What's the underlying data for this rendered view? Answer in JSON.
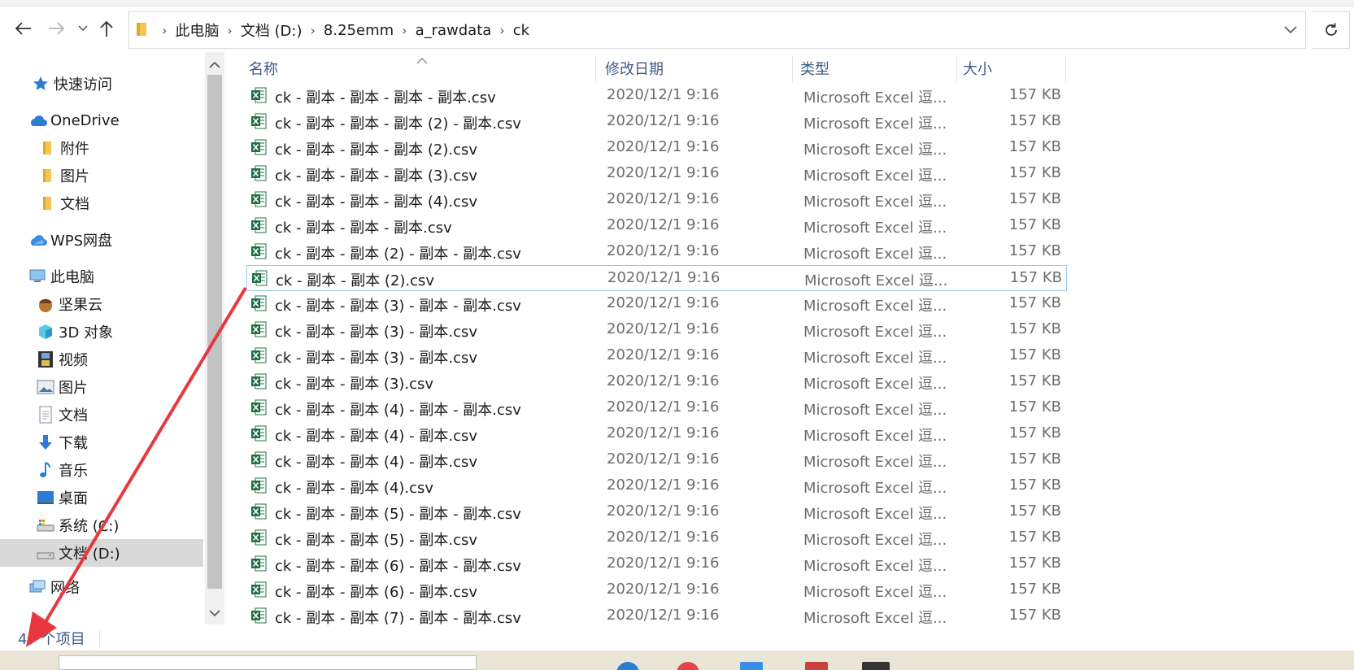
{
  "address": {
    "segments": [
      "此电脑",
      "文档 (D:)",
      "8.25emm",
      "a_rawdata",
      "ck"
    ]
  },
  "columns": {
    "name": "名称",
    "date": "修改日期",
    "type": "类型",
    "size": "大小"
  },
  "sidebar": {
    "items": [
      {
        "label": "快速访问",
        "icon": "star-icon"
      },
      {
        "label": "OneDrive",
        "icon": "cloud-icon"
      },
      {
        "label": "附件",
        "icon": "folder-icon"
      },
      {
        "label": "图片",
        "icon": "folder-icon"
      },
      {
        "label": "文档",
        "icon": "folder-icon"
      },
      {
        "label": "WPS网盘",
        "icon": "cloud-icon"
      },
      {
        "label": "此电脑",
        "icon": "computer-icon"
      },
      {
        "label": "坚果云",
        "icon": "nut-icon"
      },
      {
        "label": "3D 对象",
        "icon": "cube-icon"
      },
      {
        "label": "视频",
        "icon": "film-icon"
      },
      {
        "label": "图片",
        "icon": "picture-icon"
      },
      {
        "label": "文档",
        "icon": "document-icon"
      },
      {
        "label": "下载",
        "icon": "download-icon"
      },
      {
        "label": "音乐",
        "icon": "music-icon"
      },
      {
        "label": "桌面",
        "icon": "desktop-icon"
      },
      {
        "label": "系统 (C:)",
        "icon": "drive-icon"
      },
      {
        "label": "文档 (D:)",
        "icon": "drive-icon"
      },
      {
        "label": "网络",
        "icon": "network-icon"
      }
    ]
  },
  "files": [
    {
      "name": "ck - 副本 - 副本 - 副本 - 副本.csv",
      "date": "2020/12/1 9:16",
      "type": "Microsoft Excel 逗...",
      "size": "157 KB"
    },
    {
      "name": "ck - 副本 - 副本 - 副本 (2) - 副本.csv",
      "date": "2020/12/1 9:16",
      "type": "Microsoft Excel 逗...",
      "size": "157 KB"
    },
    {
      "name": "ck - 副本 - 副本 - 副本 (2).csv",
      "date": "2020/12/1 9:16",
      "type": "Microsoft Excel 逗...",
      "size": "157 KB"
    },
    {
      "name": "ck - 副本 - 副本 - 副本 (3).csv",
      "date": "2020/12/1 9:16",
      "type": "Microsoft Excel 逗...",
      "size": "157 KB"
    },
    {
      "name": "ck - 副本 - 副本 - 副本 (4).csv",
      "date": "2020/12/1 9:16",
      "type": "Microsoft Excel 逗...",
      "size": "157 KB"
    },
    {
      "name": "ck - 副本 - 副本 - 副本.csv",
      "date": "2020/12/1 9:16",
      "type": "Microsoft Excel 逗...",
      "size": "157 KB"
    },
    {
      "name": "ck - 副本 - 副本 (2) - 副本 - 副本.csv",
      "date": "2020/12/1 9:16",
      "type": "Microsoft Excel 逗...",
      "size": "157 KB"
    },
    {
      "name": "ck - 副本 - 副本 (2).csv",
      "date": "2020/12/1 9:16",
      "type": "Microsoft Excel 逗...",
      "size": "157 KB"
    },
    {
      "name": "ck - 副本 - 副本 (3) - 副本 - 副本.csv",
      "date": "2020/12/1 9:16",
      "type": "Microsoft Excel 逗...",
      "size": "157 KB"
    },
    {
      "name": "ck - 副本 - 副本 (3) - 副本.csv",
      "date": "2020/12/1 9:16",
      "type": "Microsoft Excel 逗...",
      "size": "157 KB"
    },
    {
      "name": "ck - 副本 - 副本 (3) - 副本.csv",
      "date": "2020/12/1 9:16",
      "type": "Microsoft Excel 逗...",
      "size": "157 KB"
    },
    {
      "name": "ck - 副本 - 副本 (3).csv",
      "date": "2020/12/1 9:16",
      "type": "Microsoft Excel 逗...",
      "size": "157 KB"
    },
    {
      "name": "ck - 副本 - 副本 (4) - 副本 - 副本.csv",
      "date": "2020/12/1 9:16",
      "type": "Microsoft Excel 逗...",
      "size": "157 KB"
    },
    {
      "name": "ck - 副本 - 副本 (4) - 副本.csv",
      "date": "2020/12/1 9:16",
      "type": "Microsoft Excel 逗...",
      "size": "157 KB"
    },
    {
      "name": "ck - 副本 - 副本 (4) - 副本.csv",
      "date": "2020/12/1 9:16",
      "type": "Microsoft Excel 逗...",
      "size": "157 KB"
    },
    {
      "name": "ck - 副本 - 副本 (4).csv",
      "date": "2020/12/1 9:16",
      "type": "Microsoft Excel 逗...",
      "size": "157 KB"
    },
    {
      "name": "ck - 副本 - 副本 (5) - 副本 - 副本.csv",
      "date": "2020/12/1 9:16",
      "type": "Microsoft Excel 逗...",
      "size": "157 KB"
    },
    {
      "name": "ck - 副本 - 副本 (5) - 副本.csv",
      "date": "2020/12/1 9:16",
      "type": "Microsoft Excel 逗...",
      "size": "157 KB"
    },
    {
      "name": "ck - 副本 - 副本 (6) - 副本 - 副本.csv",
      "date": "2020/12/1 9:16",
      "type": "Microsoft Excel 逗...",
      "size": "157 KB"
    },
    {
      "name": "ck - 副本 - 副本 (6) - 副本.csv",
      "date": "2020/12/1 9:16",
      "type": "Microsoft Excel 逗...",
      "size": "157 KB"
    },
    {
      "name": "ck - 副本 - 副本 (7) - 副本 - 副本.csv",
      "date": "2020/12/1 9:16",
      "type": "Microsoft Excel 逗...",
      "size": "157 KB"
    }
  ],
  "selected_file_index": 7,
  "status": {
    "count": "47 个项目"
  },
  "colors": {
    "header_text": "#3d5b86",
    "selection_border": "#99c9ef",
    "sidebar_selected": "#d9d9d9",
    "annotation_arrow": "#e8383d",
    "excel_green": "#1e7145"
  }
}
